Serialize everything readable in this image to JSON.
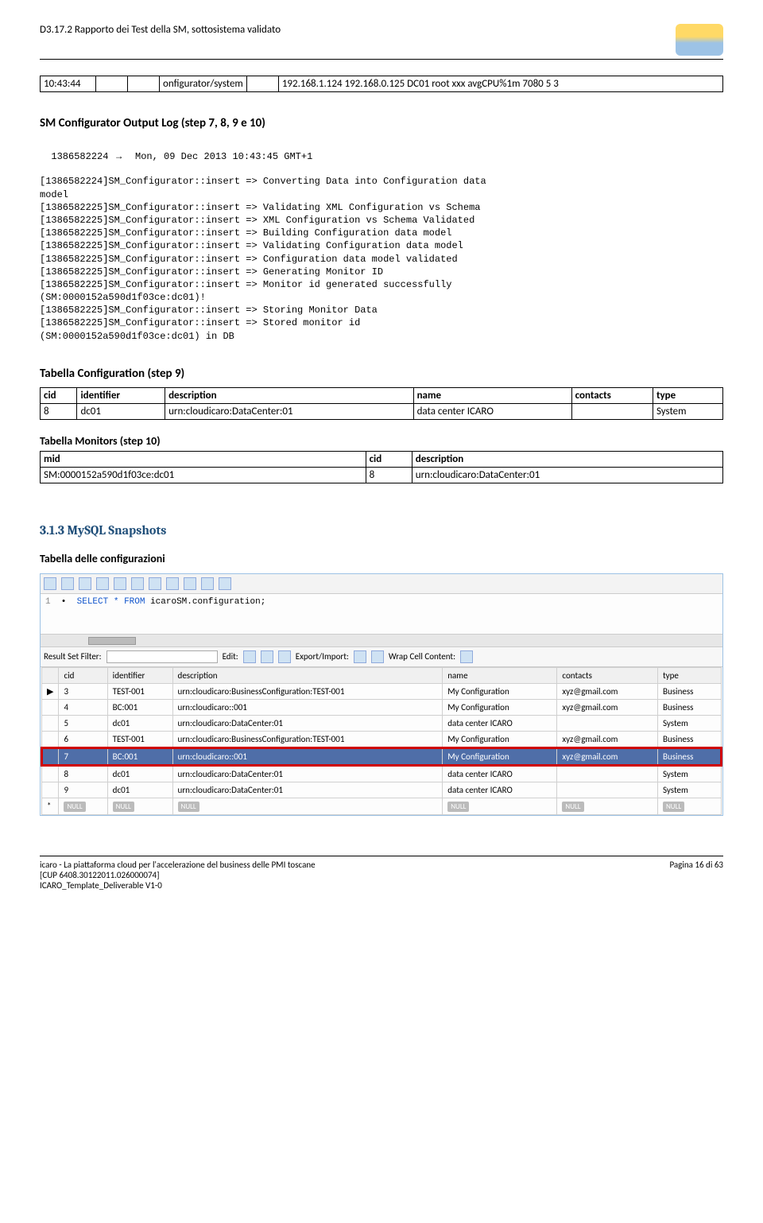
{
  "header": {
    "title": "D3.17.2 Rapporto dei Test della SM, sottosistema validato"
  },
  "table1": {
    "r": [
      "10:43:44",
      "",
      "",
      "onfigurator/system",
      "",
      "192.168.1.124 192.168.0.125 DC01 root xxx avgCPU%1m 7080 5 3"
    ]
  },
  "section1": {
    "title": "SM Configurator Output Log (step 7, 8, 9 e 10)",
    "ts_line_prefix": "1386582224 ",
    "ts_line_arrow": "→",
    "ts_line_suffix": "  Mon, 09 Dec 2013 10:43:45 GMT+1",
    "log": "[1386582224]SM_Configurator::insert => Converting Data into Configuration data\nmodel\n[1386582225]SM_Configurator::insert => Validating XML Configuration vs Schema\n[1386582225]SM_Configurator::insert => XML Configuration vs Schema Validated\n[1386582225]SM_Configurator::insert => Building Configuration data model\n[1386582225]SM_Configurator::insert => Validating Configuration data model\n[1386582225]SM_Configurator::insert => Configuration data model validated\n[1386582225]SM_Configurator::insert => Generating Monitor ID\n[1386582225]SM_Configurator::insert => Monitor id generated successfully\n(SM:0000152a590d1f03ce:dc01)!\n[1386582225]SM_Configurator::insert => Storing Monitor Data\n[1386582225]SM_Configurator::insert => Stored monitor id\n(SM:0000152a590d1f03ce:dc01) in DB"
  },
  "tabConfig": {
    "title": "Tabella Configuration (step 9)",
    "headers": [
      "cid",
      "identifier",
      "description",
      "name",
      "contacts",
      "type"
    ],
    "row": [
      "8",
      "dc01",
      "urn:cloudicaro:DataCenter:01",
      "data center ICARO",
      "",
      "System"
    ]
  },
  "tabMon": {
    "title": "Tabella Monitors (step 10)",
    "headers": [
      "mid",
      "cid",
      "description"
    ],
    "row": [
      "SM:0000152a590d1f03ce:dc01",
      "8",
      "urn:cloudicaro:DataCenter:01"
    ]
  },
  "snap": {
    "head": "3.1.3 MySQL Snapshots",
    "sub": "Tabella delle configurazioni"
  },
  "sql": {
    "line_num": "1",
    "query_select": "SELECT",
    "query_star": "*",
    "query_from": "FROM",
    "query_rest": "icaroSM.configuration;",
    "filter_label": "Result Set Filter:",
    "edit": "Edit:",
    "export": "Export/Import:",
    "wrap": "Wrap Cell Content:",
    "cols": [
      "",
      "cid",
      "identifier",
      "description",
      "name",
      "contacts",
      "type"
    ],
    "rows": [
      {
        "marker": "▶",
        "cells": [
          "3",
          "TEST-001",
          "urn:cloudicaro:BusinessConfiguration:TEST-001",
          "My Configuration",
          "xyz@gmail.com",
          "Business"
        ],
        "class": ""
      },
      {
        "marker": "",
        "cells": [
          "4",
          "BC:001",
          "urn:cloudicaro::001",
          "My Configuration",
          "xyz@gmail.com",
          "Business"
        ],
        "class": ""
      },
      {
        "marker": "",
        "cells": [
          "5",
          "dc01",
          "urn:cloudicaro:DataCenter:01",
          "data center ICARO",
          "",
          "System"
        ],
        "class": ""
      },
      {
        "marker": "",
        "cells": [
          "6",
          "TEST-001",
          "urn:cloudicaro:BusinessConfiguration:TEST-001",
          "My Configuration",
          "xyz@gmail.com",
          "Business"
        ],
        "class": ""
      },
      {
        "marker": "",
        "cells": [
          "7",
          "BC:001",
          "urn:cloudicaro::001",
          "My Configuration",
          "xyz@gmail.com",
          "Business"
        ],
        "class": "red-box-row"
      },
      {
        "marker": "",
        "cells": [
          "8",
          "dc01",
          "urn:cloudicaro:DataCenter:01",
          "data center ICARO",
          "",
          "System"
        ],
        "class": ""
      },
      {
        "marker": "",
        "cells": [
          "9",
          "dc01",
          "urn:cloudicaro:DataCenter:01",
          "data center ICARO",
          "",
          "System"
        ],
        "class": ""
      }
    ],
    "null_row_marker": "*",
    "null": "NULL"
  },
  "footer": {
    "left1": "icaro - La piattaforma cloud per l'accelerazione del business delle PMI toscane",
    "left2": "[CUP 6408.30122011.026000074]",
    "left3": "ICARO_Template_Deliverable V1-0",
    "right": "Pagina 16 di 63"
  }
}
